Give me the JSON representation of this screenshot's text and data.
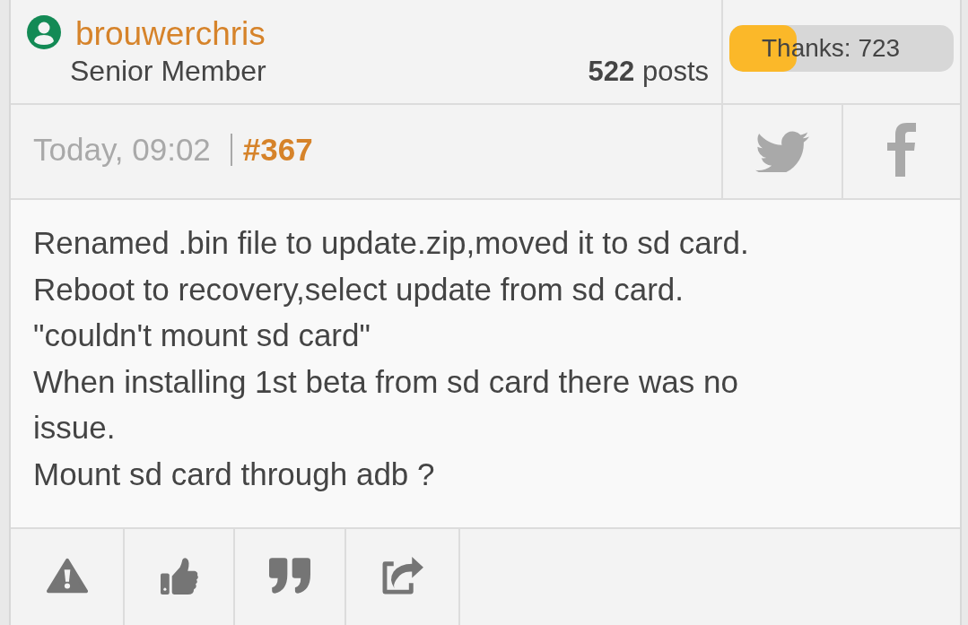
{
  "post_header": {
    "username": "brouwerchris",
    "rank": "Senior Member",
    "post_count": "**522** posts",
    "thanks": {
      "label": "Thanks: 723",
      "level": 0.3
    }
  },
  "post_meta": {
    "time": "Today, 09:02",
    "post_number": "#367"
  },
  "social_buttons": [
    {
      "kind": "twitter"
    },
    {
      "kind": "facebook"
    }
  ],
  "body": "Renamed .bin file to update.zip,moved it to sd card.\nReboot to recovery,select update from sd card.\n\"couldn't mount sd card\"\nWhen installing 1st beta from sd card there was no issue.\nMount sd card through adb ?",
  "actions": [
    {
      "kind": "report"
    },
    {
      "kind": "thanks"
    },
    {
      "kind": "quote"
    },
    {
      "kind": "share"
    }
  ]
}
